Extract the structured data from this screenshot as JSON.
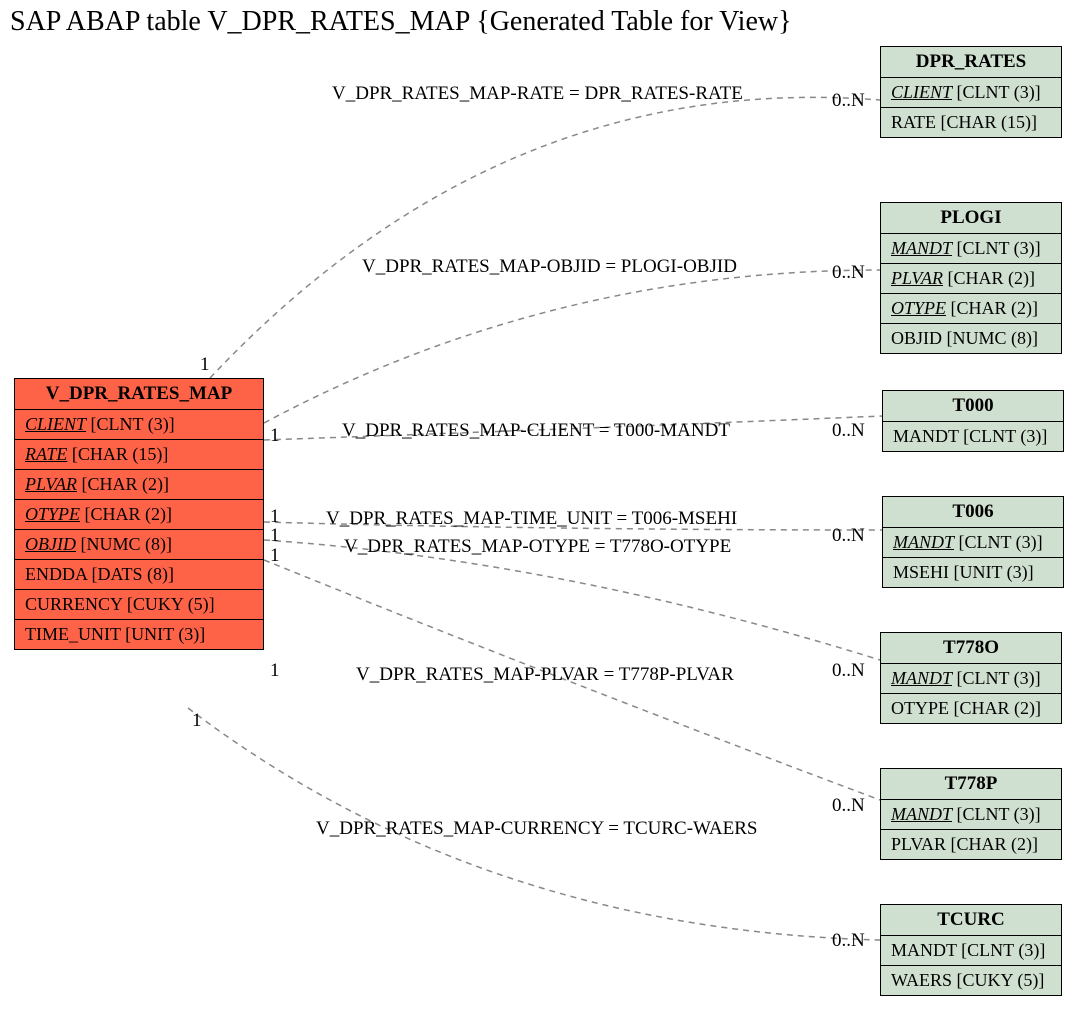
{
  "title": "SAP ABAP table V_DPR_RATES_MAP {Generated Table for View}",
  "main_table": {
    "name": "V_DPR_RATES_MAP",
    "fields": [
      {
        "name": "CLIENT",
        "type": "[CLNT (3)]",
        "key": true
      },
      {
        "name": "RATE",
        "type": "[CHAR (15)]",
        "key": true
      },
      {
        "name": "PLVAR",
        "type": "[CHAR (2)]",
        "key": true
      },
      {
        "name": "OTYPE",
        "type": "[CHAR (2)]",
        "key": true
      },
      {
        "name": "OBJID",
        "type": "[NUMC (8)]",
        "key": true
      },
      {
        "name": "ENDDA",
        "type": "[DATS (8)]",
        "key": false
      },
      {
        "name": "CURRENCY",
        "type": "[CUKY (5)]",
        "key": false
      },
      {
        "name": "TIME_UNIT",
        "type": "[UNIT (3)]",
        "key": false
      }
    ]
  },
  "ref_tables": [
    {
      "name": "DPR_RATES",
      "fields": [
        {
          "name": "CLIENT",
          "type": "[CLNT (3)]",
          "key": true
        },
        {
          "name": "RATE",
          "type": "[CHAR (15)]",
          "key": false
        }
      ]
    },
    {
      "name": "PLOGI",
      "fields": [
        {
          "name": "MANDT",
          "type": "[CLNT (3)]",
          "key": true
        },
        {
          "name": "PLVAR",
          "type": "[CHAR (2)]",
          "key": true
        },
        {
          "name": "OTYPE",
          "type": "[CHAR (2)]",
          "key": true
        },
        {
          "name": "OBJID",
          "type": "[NUMC (8)]",
          "key": false
        }
      ]
    },
    {
      "name": "T000",
      "fields": [
        {
          "name": "MANDT",
          "type": "[CLNT (3)]",
          "key": false
        }
      ]
    },
    {
      "name": "T006",
      "fields": [
        {
          "name": "MANDT",
          "type": "[CLNT (3)]",
          "key": true
        },
        {
          "name": "MSEHI",
          "type": "[UNIT (3)]",
          "key": false
        }
      ]
    },
    {
      "name": "T778O",
      "fields": [
        {
          "name": "MANDT",
          "type": "[CLNT (3)]",
          "key": true
        },
        {
          "name": "OTYPE",
          "type": "[CHAR (2)]",
          "key": false
        }
      ]
    },
    {
      "name": "T778P",
      "fields": [
        {
          "name": "MANDT",
          "type": "[CLNT (3)]",
          "key": true
        },
        {
          "name": "PLVAR",
          "type": "[CHAR (2)]",
          "key": false
        }
      ]
    },
    {
      "name": "TCURC",
      "fields": [
        {
          "name": "MANDT",
          "type": "[CLNT (3)]",
          "key": false
        },
        {
          "name": "WAERS",
          "type": "[CUKY (5)]",
          "key": false
        }
      ]
    }
  ],
  "relations": [
    {
      "label": "V_DPR_RATES_MAP-RATE = DPR_RATES-RATE",
      "left_card": "1",
      "right_card": "0..N"
    },
    {
      "label": "V_DPR_RATES_MAP-OBJID = PLOGI-OBJID",
      "left_card": "1",
      "right_card": "0..N"
    },
    {
      "label": "V_DPR_RATES_MAP-CLIENT = T000-MANDT",
      "left_card": "1",
      "right_card": "0..N"
    },
    {
      "label": "V_DPR_RATES_MAP-TIME_UNIT = T006-MSEHI",
      "left_card": "1",
      "right_card": "0..N"
    },
    {
      "label": "V_DPR_RATES_MAP-OTYPE = T778O-OTYPE",
      "left_card": "1",
      "right_card": "0..N"
    },
    {
      "label": "V_DPR_RATES_MAP-PLVAR = T778P-PLVAR",
      "left_card": "1",
      "right_card": "0..N"
    },
    {
      "label": "V_DPR_RATES_MAP-CURRENCY = TCURC-WAERS",
      "left_card": "1",
      "right_card": "0..N"
    }
  ]
}
